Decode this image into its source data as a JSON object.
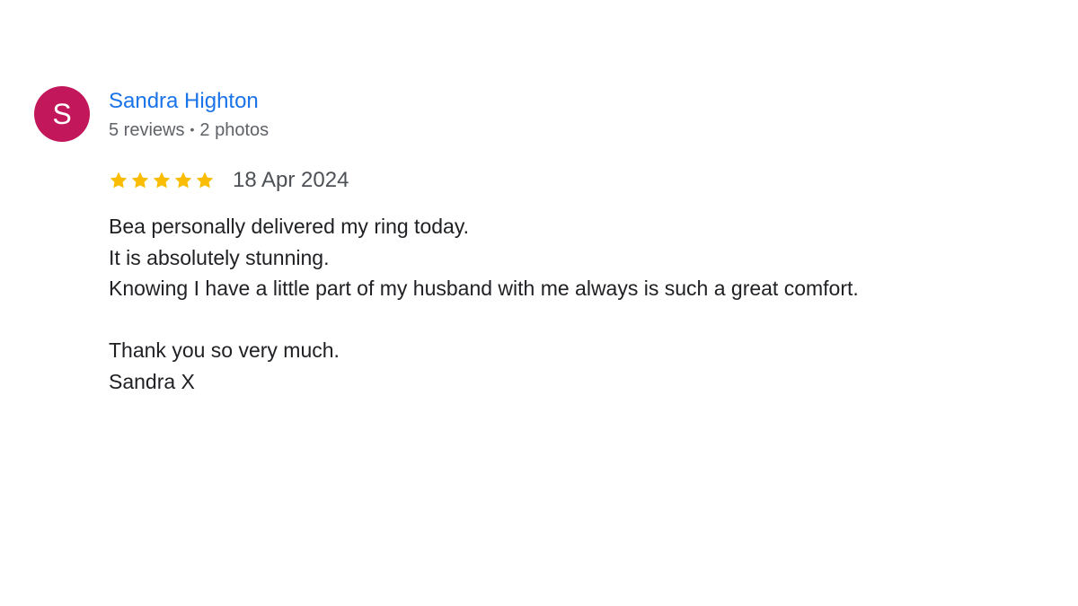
{
  "colors": {
    "avatar_bg": "#c2185b",
    "author_link": "#1a73e8",
    "star": "#fbbc04"
  },
  "review": {
    "avatar_initial": "S",
    "author_name": "Sandra Highton",
    "reviews_count": "5 reviews",
    "separator": "•",
    "photos_count": "2 photos",
    "rating": 5,
    "rating_max": 5,
    "star_icon": "star-icon",
    "date": "18 Apr 2024",
    "text_lines": [
      "Bea personally delivered my ring today.",
      "It is absolutely stunning.",
      "Knowing I have a little part of my husband with me always is such a great comfort.",
      "",
      "Thank you so very much.",
      "Sandra X"
    ]
  }
}
